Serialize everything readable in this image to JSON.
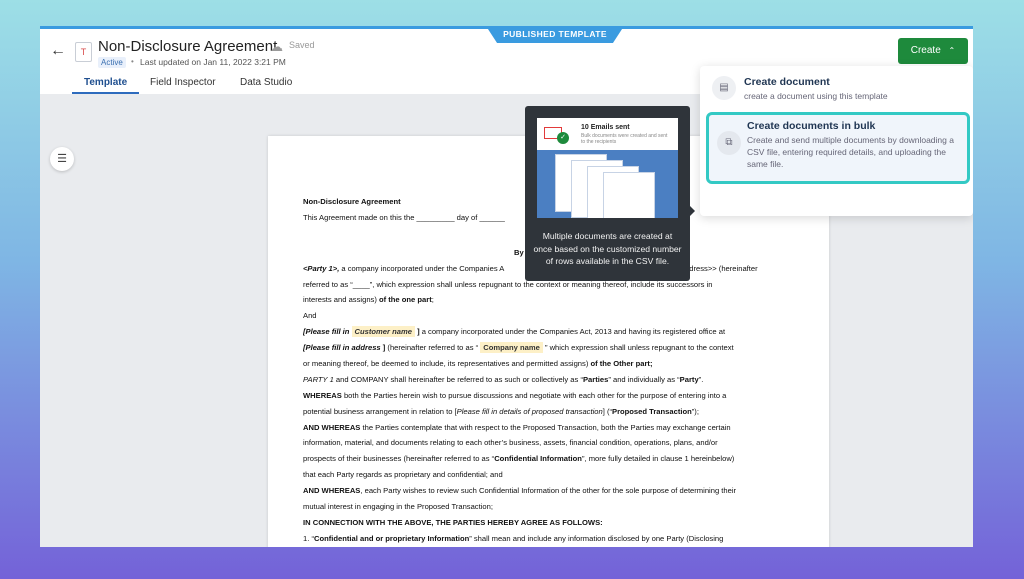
{
  "header": {
    "published_label": "PUBLISHED TEMPLATE",
    "back_glyph": "←",
    "doc_icon_letter": "T",
    "title": "Non-Disclosure Agreement",
    "saved": "Saved",
    "status_badge": "Active",
    "last_updated": "Last updated on Jan 11, 2022 3:21 PM",
    "tabs": [
      {
        "label": "Template",
        "active": true
      },
      {
        "label": "Field Inspector",
        "active": false
      },
      {
        "label": "Data Studio",
        "active": false
      }
    ],
    "create_label": "Create"
  },
  "menu": {
    "items": [
      {
        "title": "Create document",
        "desc": "create a document using this template"
      },
      {
        "title": "Create documents in bulk",
        "desc": "Create and send multiple documents by downloading a CSV file, entering required details, and uploading the same file."
      }
    ]
  },
  "tooltip": {
    "card_title": "10 Emails sent",
    "card_sub": "Bulk documents were created and sent to the recipients",
    "message": "Multiple documents are created at once based on the customized number of rows available in the CSV file."
  },
  "document": {
    "heading": "Non-Disclosure Agreement",
    "line1": "This Agreement made on this the _________ day of ______",
    "by": "By",
    "party1_a": "<Party 1>,",
    "party1_b": " a company incorporated under the Companies A",
    "party1_c": "<address>> (hereinafter",
    "line_ref": "referred to as “____”, which expression shall unless repugnant to the context or meaning thereof, include its successors in",
    "line_interests_a": "interests and assigns) ",
    "line_interests_b": "of the one part",
    "line_interests_c": ";",
    "and": "And",
    "p2_a": "[Please fill in ",
    "p2_field": "Customer name",
    "p2_b": " ]",
    "p2_c": " a company incorporated under the Companies Act, 2013 and having its registered office at",
    "p3_a": "[Please fill in address",
    "p3_b": "  ]",
    "p3_c": " (hereinafter referred to as “ ",
    "p3_field": "Company name",
    "p3_d": " ” which expression shall unless repugnant to the context",
    "p4_a": "or meaning thereof, be deemed to include, its representatives and permitted assigns) ",
    "p4_b": "of the Other part;",
    "p5_a": "PARTY 1",
    "p5_b": " and COMPANY shall hereinafter be referred to as such or collectively as “",
    "p5_c": "Parties",
    "p5_d": "” and individually as “",
    "p5_e": "Party",
    "p5_f": "”.",
    "p6_a": "WHEREAS",
    "p6_b": " both the Parties herein wish to pursue discussions and negotiate with each other for the purpose of entering into a",
    "p7_a": "potential business arrangement in relation to [",
    "p7_b": "Please fill in details of proposed transaction",
    "p7_c": "] (“",
    "p7_d": "Proposed Transaction",
    "p7_e": "”);",
    "p8_a": "AND WHEREAS",
    "p8_b": " the Parties contemplate that with respect to the Proposed Transaction, both the Parties may exchange certain",
    "p9": "information, material, and documents relating to each other’s business, assets, financial condition, operations, plans, and/or",
    "p10_a": "prospects of their businesses (hereinafter referred to as “",
    "p10_b": "Confidential Information",
    "p10_c": "”, more fully detailed in clause 1 hereinbelow)",
    "p11": "that each Party regards as proprietary and confidential; and",
    "p12_a": "AND WHEREAS",
    "p12_b": ", each Party wishes to review such Confidential Information of the other for the sole purpose of determining their",
    "p13": "mutual interest in engaging in the Proposed Transaction;",
    "p14": "IN CONNECTION WITH THE ABOVE, THE PARTIES HEREBY AGREE AS FOLLOWS:",
    "p15_a": "1. “",
    "p15_b": "Confidential and or proprietary Information",
    "p15_c": "” shall mean and include any information disclosed by one Party (Disclosing"
  }
}
